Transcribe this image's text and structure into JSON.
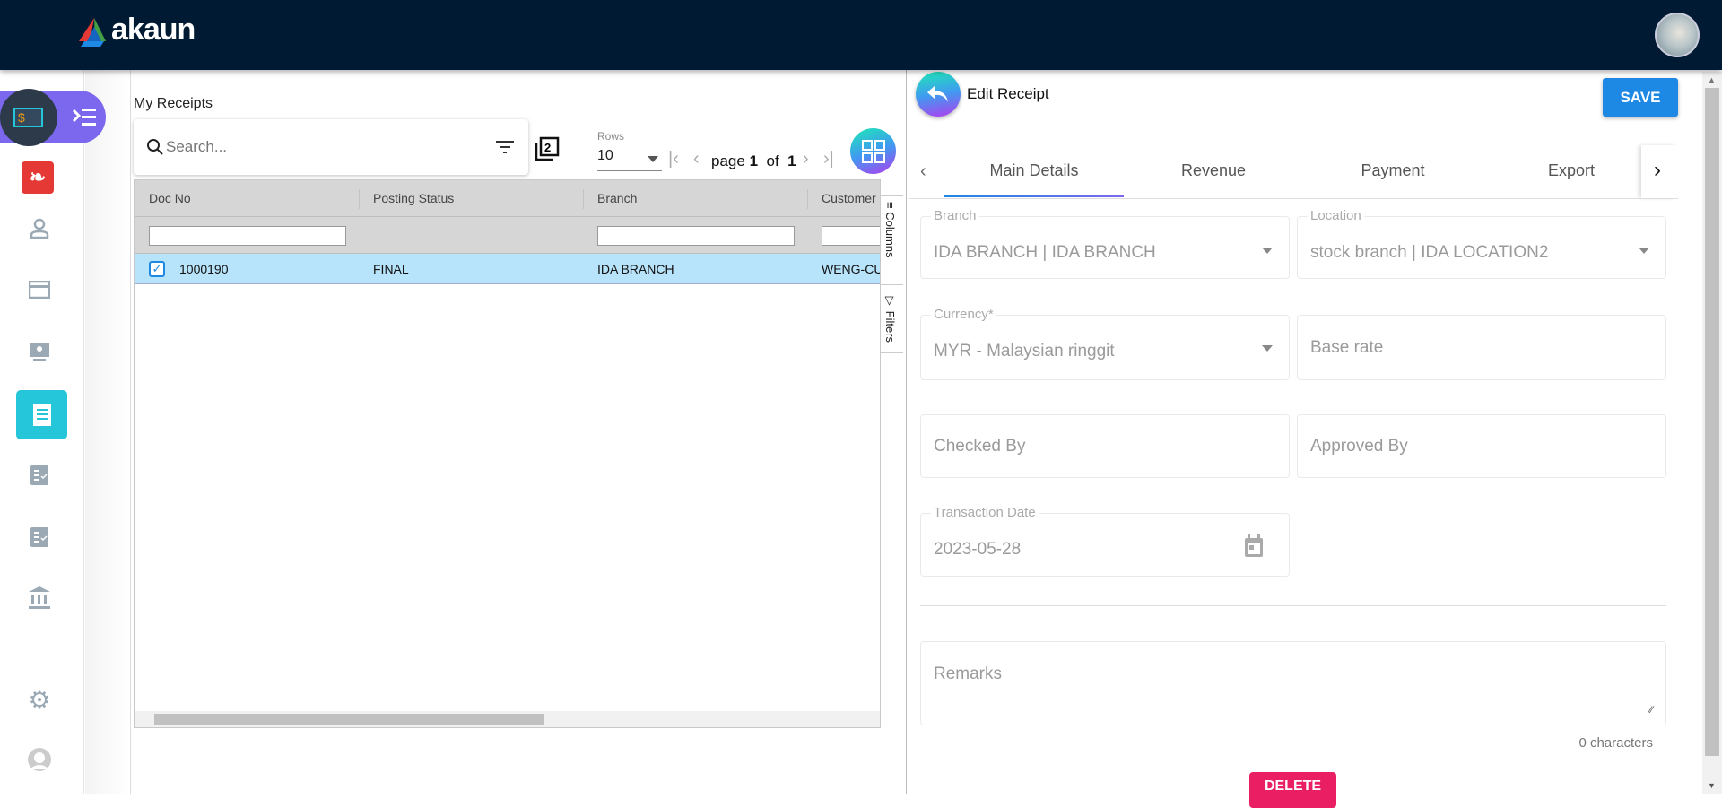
{
  "header": {
    "logo_text": "akaun",
    "brand_colors": [
      "#e53935",
      "#43a047",
      "#1e88e5"
    ]
  },
  "sidebar": {
    "items": [
      "app-menu",
      "acrobat",
      "contacts",
      "card",
      "monitor",
      "receipts",
      "checklist-1",
      "checklist-2",
      "bank",
      "settings",
      "profile"
    ],
    "active": "receipts",
    "active_color": "#26c6da",
    "menu_pill_color": "#7b68ee"
  },
  "list": {
    "title": "My Receipts",
    "search_placeholder": "Search...",
    "rows_label": "Rows",
    "rows_value": "10",
    "pager": {
      "page_word": "page",
      "page": "1",
      "of_word": "of",
      "total": "1"
    },
    "columns": [
      "Doc No",
      "Posting Status",
      "Branch",
      "Customer"
    ],
    "rows": [
      {
        "doc_no": "1000190",
        "posting_status": "FINAL",
        "branch": "IDA BRANCH",
        "customer": "WENG-CU",
        "checked": true
      }
    ],
    "side_tabs": {
      "columns": "Columns",
      "filters": "Filters"
    }
  },
  "edit": {
    "title": "Edit Receipt",
    "save_label": "SAVE",
    "tabs": [
      "Main Details",
      "Revenue",
      "Payment",
      "Export"
    ],
    "active_tab": "Main Details",
    "fields": {
      "branch": {
        "label": "Branch",
        "value": "IDA BRANCH | IDA BRANCH"
      },
      "location": {
        "label": "Location",
        "value": "stock branch | IDA LOCATION2"
      },
      "currency": {
        "label": "Currency*",
        "value": "MYR - Malaysian ringgit"
      },
      "base_rate": {
        "placeholder": "Base rate"
      },
      "checked_by": {
        "placeholder": "Checked By"
      },
      "approved_by": {
        "placeholder": "Approved By"
      },
      "transaction_date": {
        "label": "Transaction Date",
        "value": "2023-05-28"
      },
      "remarks": {
        "placeholder": "Remarks",
        "counter": "0 characters"
      }
    },
    "delete_label": "DELETE"
  }
}
